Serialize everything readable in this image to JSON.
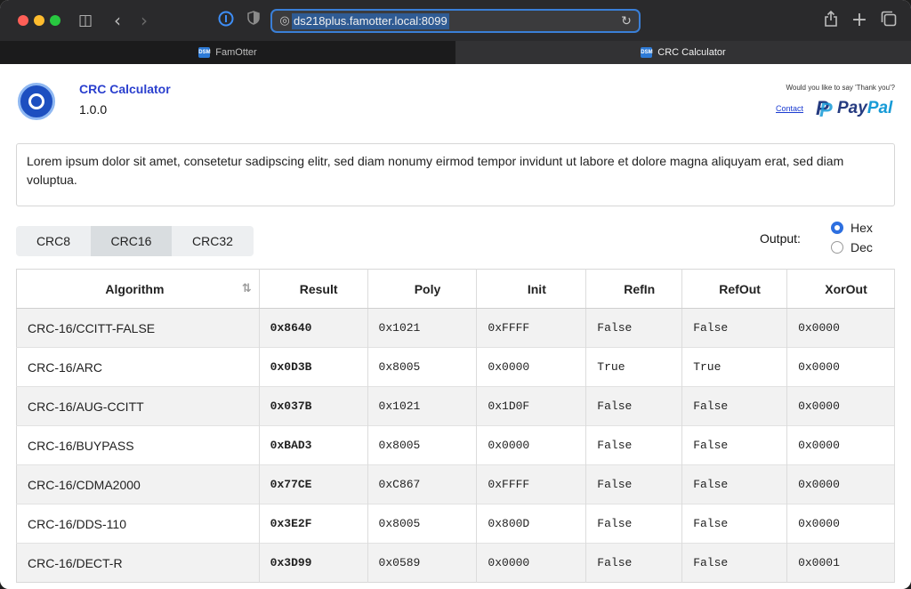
{
  "browser": {
    "url": "ds218plus.famotter.local:8099",
    "tabs": [
      {
        "label": "FamOtter",
        "favicon": "DSM",
        "active": false
      },
      {
        "label": "CRC Calculator",
        "favicon": "DSM",
        "active": true
      }
    ],
    "icons": {
      "sidebar": "sidebar-icon",
      "back": "chevron-left-icon",
      "forward": "chevron-right-icon",
      "password": "1password-icon",
      "privacy": "shield-icon",
      "site": "globe-icon",
      "reload": "reload-icon",
      "share": "share-icon",
      "new_tab": "plus-icon",
      "tabs": "tab-overview-icon"
    }
  },
  "header": {
    "title": "CRC Calculator",
    "version": "1.0.0",
    "thanks": "Would you like to say 'Thank you'?",
    "contact": "Contact",
    "paypal_a": "Pay",
    "paypal_b": "Pal"
  },
  "input_text": "Lorem ipsum dolor sit amet, consetetur sadipscing elitr, sed diam nonumy eirmod tempor invidunt ut labore et dolore magna aliquyam erat, sed diam voluptua.",
  "crc_tabs": [
    {
      "label": "CRC8",
      "selected": false
    },
    {
      "label": "CRC16",
      "selected": true
    },
    {
      "label": "CRC32",
      "selected": false
    }
  ],
  "output": {
    "label": "Output:",
    "options": [
      {
        "label": "Hex",
        "checked": true
      },
      {
        "label": "Dec",
        "checked": false
      }
    ]
  },
  "table": {
    "columns": [
      "Algorithm",
      "Result",
      "Poly",
      "Init",
      "RefIn",
      "RefOut",
      "XorOut"
    ],
    "rows": [
      [
        "CRC-16/CCITT-FALSE",
        "0x8640",
        "0x1021",
        "0xFFFF",
        "False",
        "False",
        "0x0000"
      ],
      [
        "CRC-16/ARC",
        "0x0D3B",
        "0x8005",
        "0x0000",
        "True",
        "True",
        "0x0000"
      ],
      [
        "CRC-16/AUG-CCITT",
        "0x037B",
        "0x1021",
        "0x1D0F",
        "False",
        "False",
        "0x0000"
      ],
      [
        "CRC-16/BUYPASS",
        "0xBAD3",
        "0x8005",
        "0x0000",
        "False",
        "False",
        "0x0000"
      ],
      [
        "CRC-16/CDMA2000",
        "0x77CE",
        "0xC867",
        "0xFFFF",
        "False",
        "False",
        "0x0000"
      ],
      [
        "CRC-16/DDS-110",
        "0x3E2F",
        "0x8005",
        "0x800D",
        "False",
        "False",
        "0x0000"
      ],
      [
        "CRC-16/DECT-R",
        "0x3D99",
        "0x0589",
        "0x0000",
        "False",
        "False",
        "0x0001"
      ]
    ]
  }
}
